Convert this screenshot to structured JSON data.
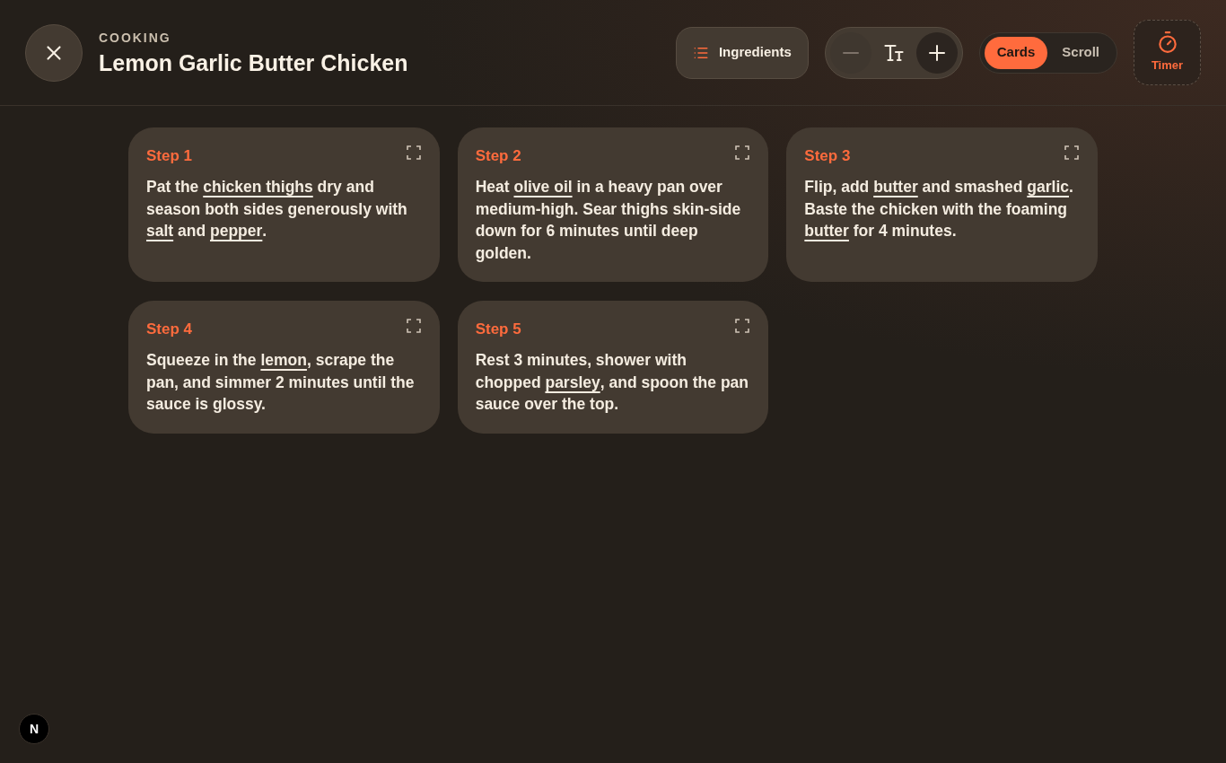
{
  "header": {
    "category": "COOKING",
    "title": "Lemon Garlic Butter Chicken"
  },
  "toolbar": {
    "ingredients_button": {
      "label": "Ingredients"
    },
    "font_size": {
      "decrease": {
        "disabled": true
      },
      "increase": {
        "disabled": false
      }
    },
    "view_mode": [
      {
        "label": "Cards",
        "selected": true
      },
      {
        "label": "Scroll",
        "selected": false
      }
    ],
    "timer_button": {
      "label": "Timer"
    }
  },
  "steps": [
    {
      "label": "Step 1",
      "text": "Pat the **chicken thighs** dry and season both sides generously with **salt** and **pepper**."
    },
    {
      "label": "Step 2",
      "text": "Heat **olive oil** in a heavy pan over medium-high. Sear thighs skin-side down for 6 minutes until deep golden."
    },
    {
      "label": "Step 3",
      "text": "Flip, add **butter** and smashed **garlic**. Baste the chicken with the foaming **butter** for 4 minutes."
    },
    {
      "label": "Step 4",
      "text": "Squeeze in the **lemon**, scrape the pan, and simmer 2 minutes until the sauce is glossy."
    },
    {
      "label": "Step 5",
      "text": "Rest 3 minutes, shower with chopped **parsley**, and spoon the pan sauce over the top."
    }
  ],
  "dev_badge": {
    "label": "N"
  }
}
